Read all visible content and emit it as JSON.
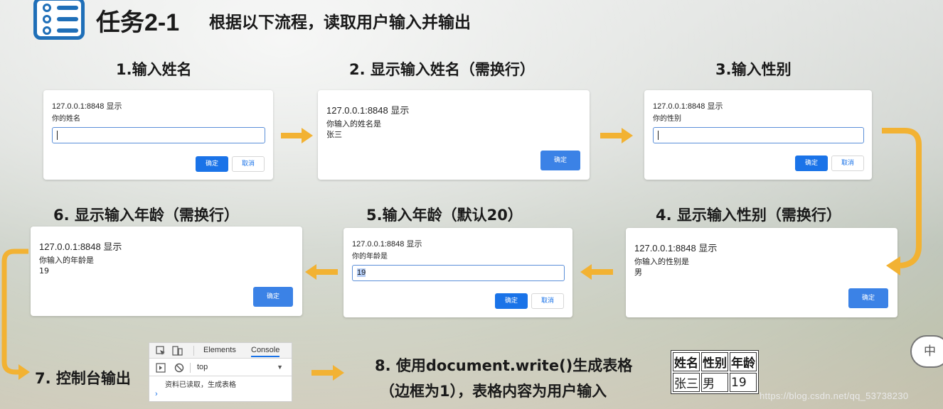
{
  "header": {
    "task_title": "任务2-1",
    "task_desc": "根据以下流程，读取用户输入并输出"
  },
  "steps": {
    "s1": "1.输入姓名",
    "s2": "2. 显示输入姓名（需换行）",
    "s3": "3.输入性别",
    "s4": "4. 显示输入性别（需换行）",
    "s5": "5.输入年龄（默认20）",
    "s6": "6. 显示输入年龄（需换行）",
    "s7": "7. 控制台输出",
    "s8_line1": "8. 使用document.write()生成表格",
    "s8_line2": "（边框为1），表格内容为用户输入"
  },
  "dialogs": {
    "d1": {
      "origin": "127.0.0.1:8848 显示",
      "prompt": "你的姓名",
      "ok": "确定",
      "cancel": "取消"
    },
    "d2": {
      "origin": "127.0.0.1:8848 显示",
      "prompt": "你输入的姓名是\n张三",
      "ok": "确定"
    },
    "d3": {
      "origin": "127.0.0.1:8848 显示",
      "prompt": "你的性别",
      "ok": "确定",
      "cancel": "取消"
    },
    "d4": {
      "origin": "127.0.0.1:8848 显示",
      "prompt": "你输入的性别是\n男",
      "ok": "确定"
    },
    "d5": {
      "origin": "127.0.0.1:8848 显示",
      "prompt": "你的年龄是",
      "value": "19",
      "ok": "确定",
      "cancel": "取消"
    },
    "d6": {
      "origin": "127.0.0.1:8848 显示",
      "prompt": "你输入的年龄是\n19",
      "ok": "确定"
    }
  },
  "devtools": {
    "tab_elements": "Elements",
    "tab_console": "Console",
    "context": "top",
    "log": "资料已读取，生成表格",
    "prompt": "›"
  },
  "table": {
    "headers": [
      "姓名",
      "性别",
      "年龄"
    ],
    "row": [
      "张三",
      "男",
      "19"
    ]
  },
  "side_button": "中",
  "watermark": "https://blog.csdn.net/qq_53738230",
  "colors": {
    "arrow": "#f2b233",
    "button": "#1a73e8",
    "accent": "#1f6fb8"
  }
}
